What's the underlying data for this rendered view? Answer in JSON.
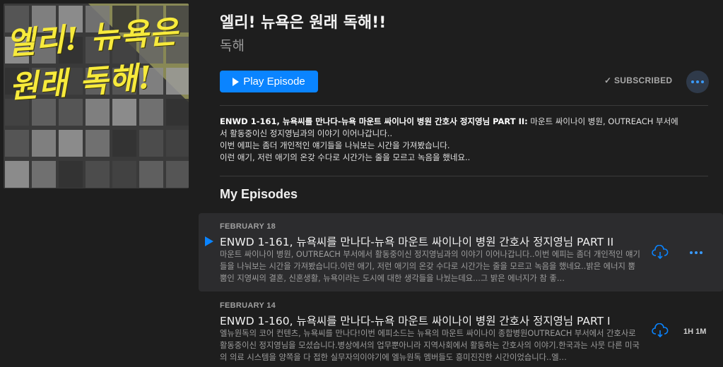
{
  "podcast": {
    "artwork_text": "엘리! 뉴욕은 원래 독해!",
    "title": "엘리! 뉴욕은 원래 독해!!",
    "author": "독해"
  },
  "actions": {
    "play_label": "Play Episode",
    "subscribed_label": "SUBSCRIBED",
    "accent_color": "#0a84ff"
  },
  "featured": {
    "bold": "ENWD 1-161, 뉴욕씨를 만나다-뉴욕 마운트 싸이나이 병원 간호사 정지영님 PART II:",
    "line1_rest": " 마운트 싸이나이 병원, OUTREACH 부서에",
    "line2": "서 활동중이신 정지영님과의 이야기 이어나갑니다..",
    "line3": "이번 에피는 좀더 개인적인 얘기들을 나눠보는 시간을 가져봤습니다.",
    "line4": "이런 애기, 저런 애기의 온갖 수다로 시간가는 줄을 모르고 녹음을 했네요.."
  },
  "section": {
    "title": "My Episodes"
  },
  "episodes": [
    {
      "date": "FEBRUARY 18",
      "title": "ENWD 1-161, 뉴욕씨를 만나다-뉴욕 마운트 싸이나이 병원 간호사 정지영님 PART II",
      "desc": "마운트 싸이나이 병원, OUTREACH 부서에서 활동중이신 정지영님과의 이야기 이어나갑니다..이번 에피는 좀더 개인적인 얘기들을 나눠보는 시간을 가져봤습니다.이런 애기, 저런 애기의 온갖 수다로 시간가는 줄을 모르고 녹음을 했네요..밝은 에너지 뿜뿜인 지영씨의 결혼, 신혼생활, 뉴욕이라는 도시에 대한 생각들을 나눴는데요...그 밝은 에너지가 참 좋…"
    },
    {
      "date": "FEBRUARY 14",
      "title": "ENWD 1-160, 뉴욕씨를 만나다-뉴욕 마운트 싸이나이 병원 간호사 정지영님 PART I",
      "desc": "엘뉴원독의 코어 컨텐츠, 뉴욕씨를 만나다!이번 에피소드는 뉴욕의 마운트 싸이나이 종합병원OUTREACH 부서에서 간호사로 활동중이신 정지영님을 모셨습니다.병상에서의 업무뿐아니라 지역사회에서 활동하는 간호사의 이야기.한국과는 사뭇 다른 미국의 의료 시스템을 양쪽을 다 접한 실무자의이야기에 엘뉴원독 멤버들도 흥미진진한 시간이었습니다..엘…",
      "duration": "1H 1M"
    }
  ]
}
